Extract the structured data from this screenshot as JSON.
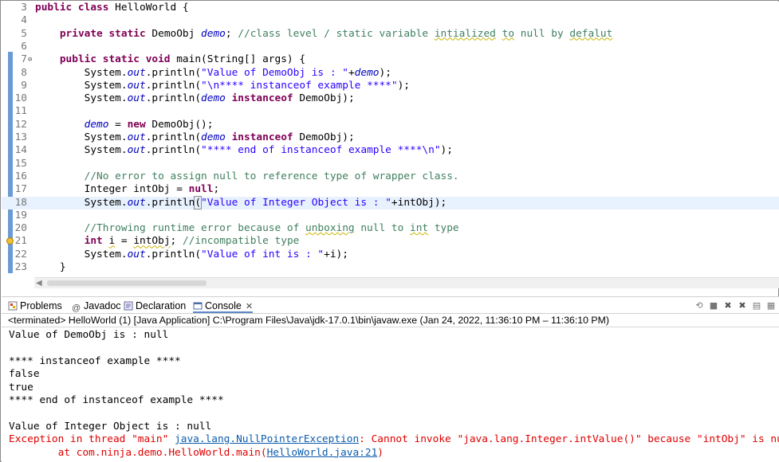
{
  "editor": {
    "lines": [
      {
        "num": "3",
        "tokens": [
          {
            "t": "public class ",
            "c": "kw"
          },
          {
            "t": "HelloWorld {",
            "c": ""
          }
        ]
      },
      {
        "num": "4",
        "tokens": []
      },
      {
        "num": "5",
        "tokens": [
          {
            "t": "    ",
            "c": ""
          },
          {
            "t": "private static ",
            "c": "kw"
          },
          {
            "t": "DemoObj ",
            "c": ""
          },
          {
            "t": "demo",
            "c": "fld"
          },
          {
            "t": "; ",
            "c": ""
          },
          {
            "t": "//class level / static variable ",
            "c": "cm"
          },
          {
            "t": "intialized",
            "c": "cm sq"
          },
          {
            "t": " ",
            "c": "cm"
          },
          {
            "t": "to",
            "c": "cm sq"
          },
          {
            "t": " null by ",
            "c": "cm"
          },
          {
            "t": "defalut",
            "c": "cm sq"
          }
        ]
      },
      {
        "num": "6",
        "tokens": []
      },
      {
        "num": "7",
        "fold": true,
        "tokens": [
          {
            "t": "    ",
            "c": ""
          },
          {
            "t": "public static void ",
            "c": "kw"
          },
          {
            "t": "main(String[] ",
            "c": ""
          },
          {
            "t": "args",
            "c": ""
          },
          {
            "t": ") {",
            "c": ""
          }
        ]
      },
      {
        "num": "8",
        "tokens": [
          {
            "t": "        System.",
            "c": ""
          },
          {
            "t": "out",
            "c": "fld"
          },
          {
            "t": ".println(",
            "c": ""
          },
          {
            "t": "\"Value of DemoObj is : \"",
            "c": "str"
          },
          {
            "t": "+",
            "c": ""
          },
          {
            "t": "demo",
            "c": "fld"
          },
          {
            "t": ");",
            "c": ""
          }
        ]
      },
      {
        "num": "9",
        "tokens": [
          {
            "t": "        System.",
            "c": ""
          },
          {
            "t": "out",
            "c": "fld"
          },
          {
            "t": ".println(",
            "c": ""
          },
          {
            "t": "\"\\n**** instanceof example ****\"",
            "c": "str"
          },
          {
            "t": ");",
            "c": ""
          }
        ]
      },
      {
        "num": "10",
        "tokens": [
          {
            "t": "        System.",
            "c": ""
          },
          {
            "t": "out",
            "c": "fld"
          },
          {
            "t": ".println(",
            "c": ""
          },
          {
            "t": "demo",
            "c": "fld"
          },
          {
            "t": " ",
            "c": ""
          },
          {
            "t": "instanceof ",
            "c": "kw"
          },
          {
            "t": "DemoObj);",
            "c": ""
          }
        ]
      },
      {
        "num": "11",
        "tokens": []
      },
      {
        "num": "12",
        "tokens": [
          {
            "t": "        ",
            "c": ""
          },
          {
            "t": "demo",
            "c": "fld"
          },
          {
            "t": " = ",
            "c": ""
          },
          {
            "t": "new ",
            "c": "kw"
          },
          {
            "t": "DemoObj();",
            "c": ""
          }
        ]
      },
      {
        "num": "13",
        "tokens": [
          {
            "t": "        System.",
            "c": ""
          },
          {
            "t": "out",
            "c": "fld"
          },
          {
            "t": ".println(",
            "c": ""
          },
          {
            "t": "demo",
            "c": "fld"
          },
          {
            "t": " ",
            "c": ""
          },
          {
            "t": "instanceof ",
            "c": "kw"
          },
          {
            "t": "DemoObj);",
            "c": ""
          }
        ]
      },
      {
        "num": "14",
        "tokens": [
          {
            "t": "        System.",
            "c": ""
          },
          {
            "t": "out",
            "c": "fld"
          },
          {
            "t": ".println(",
            "c": ""
          },
          {
            "t": "\"**** end of instanceof example ****\\n\"",
            "c": "str"
          },
          {
            "t": ");",
            "c": ""
          }
        ]
      },
      {
        "num": "15",
        "tokens": []
      },
      {
        "num": "16",
        "tokens": [
          {
            "t": "        ",
            "c": ""
          },
          {
            "t": "//No error to assign null to reference type of wrapper class.",
            "c": "cm"
          }
        ]
      },
      {
        "num": "17",
        "tokens": [
          {
            "t": "        Integer ",
            "c": ""
          },
          {
            "t": "intObj",
            "c": ""
          },
          {
            "t": " = ",
            "c": ""
          },
          {
            "t": "null",
            "c": "kw"
          },
          {
            "t": ";",
            "c": ""
          }
        ]
      },
      {
        "num": "18",
        "current": true,
        "tokens": [
          {
            "t": "        System.",
            "c": ""
          },
          {
            "t": "out",
            "c": "fld"
          },
          {
            "t": ".println",
            "c": ""
          },
          {
            "t": "(",
            "c": "bracket"
          },
          {
            "t": "\"Value of Integer Object is : \"",
            "c": "str"
          },
          {
            "t": "+intObj);",
            "c": ""
          }
        ]
      },
      {
        "num": "19",
        "tokens": []
      },
      {
        "num": "20",
        "tokens": [
          {
            "t": "        ",
            "c": ""
          },
          {
            "t": "//Throwing runtime error because of ",
            "c": "cm"
          },
          {
            "t": "unboxing",
            "c": "cm sq"
          },
          {
            "t": " null to ",
            "c": "cm"
          },
          {
            "t": "int",
            "c": "cm sq"
          },
          {
            "t": " type",
            "c": "cm"
          }
        ]
      },
      {
        "num": "21",
        "warning": true,
        "tokens": [
          {
            "t": "        ",
            "c": ""
          },
          {
            "t": "int ",
            "c": "kw"
          },
          {
            "t": "i",
            "c": "sq"
          },
          {
            "t": " = ",
            "c": ""
          },
          {
            "t": "intObj",
            "c": "sq"
          },
          {
            "t": "; ",
            "c": ""
          },
          {
            "t": "//incompatible type",
            "c": "cm"
          }
        ]
      },
      {
        "num": "22",
        "tokens": [
          {
            "t": "        System.",
            "c": ""
          },
          {
            "t": "out",
            "c": "fld"
          },
          {
            "t": ".println(",
            "c": ""
          },
          {
            "t": "\"Value of int is : \"",
            "c": "str"
          },
          {
            "t": "+i);",
            "c": ""
          }
        ]
      },
      {
        "num": "23",
        "tokens": [
          {
            "t": "    }",
            "c": ""
          }
        ]
      }
    ]
  },
  "tabs": [
    {
      "label": "Problems",
      "icon": "problems-icon"
    },
    {
      "label": "Javadoc",
      "icon": "at-icon"
    },
    {
      "label": "Declaration",
      "icon": "declaration-icon"
    },
    {
      "label": "Console",
      "icon": "console-icon",
      "active": true
    }
  ],
  "console_header": "<terminated> HelloWorld (1) [Java Application] C:\\Program Files\\Java\\jdk-17.0.1\\bin\\javaw.exe  (Jan 24, 2022, 11:36:10 PM – 11:36:10 PM)",
  "console_output": {
    "l1": "Value of DemoObj is : null",
    "l2": "",
    "l3": "**** instanceof example ****",
    "l4": "false",
    "l5": "true",
    "l6": "**** end of instanceof example ****",
    "l7": "",
    "l8": "Value of Integer Object is : null",
    "err_prefix": "Exception in thread \"main\" ",
    "err_exception": "java.lang.NullPointerException",
    "err_message": ": Cannot invoke \"java.lang.Integer.intValue()\" because \"intObj\" is null",
    "trace_prefix": "\tat com.ninja.demo.HelloWorld.main(",
    "trace_link": "HelloWorld.java:21",
    "trace_suffix": ")"
  },
  "colors": {
    "keyword": "#7f0055",
    "field": "#0000c0",
    "comment": "#3f7f5f",
    "string": "#2a00ff",
    "error": "#e00000",
    "link": "#0b5cad",
    "current_line": "#e8f2fe"
  }
}
